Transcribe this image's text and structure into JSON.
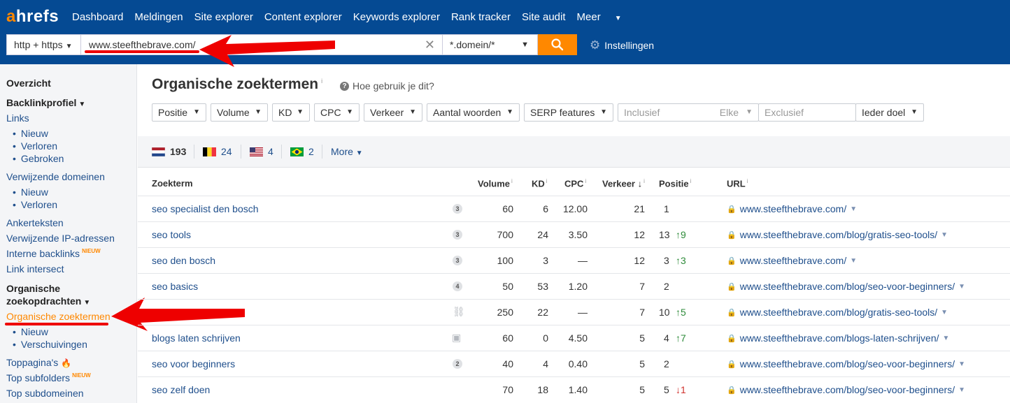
{
  "brand": {
    "logo_a": "a",
    "logo_rest": "hrefs",
    "accent": "#ff8800",
    "nav_bg": "#054a93"
  },
  "nav": {
    "items": [
      "Dashboard",
      "Meldingen",
      "Site explorer",
      "Content explorer",
      "Keywords explorer",
      "Rank tracker",
      "Site audit",
      "Meer"
    ]
  },
  "search": {
    "protocol": "http + https",
    "url": "www.steefthebrave.com/",
    "mode": "*.domein/*",
    "settings": "Instellingen"
  },
  "sidebar": {
    "overzicht": "Overzicht",
    "backlinkprofiel": "Backlinkprofiel",
    "links": "Links",
    "links_nieuw": "Nieuw",
    "links_verloren": "Verloren",
    "links_gebroken": "Gebroken",
    "ref_domains": "Verwijzende domeinen",
    "rd_nieuw": "Nieuw",
    "rd_verloren": "Verloren",
    "anchors": "Ankerteksten",
    "ref_ips": "Verwijzende IP-adressen",
    "internal": "Interne backlinks",
    "new_badge": "NIEUW",
    "link_intersect": "Link intersect",
    "organic_1": "Organische",
    "organic_2": "zoekopdrachten",
    "organic_kw": "Organische zoektermen",
    "org_nieuw": "Nieuw",
    "org_shifts": "Verschuivingen",
    "top_pages": "Toppagina's",
    "top_subfolders": "Top subfolders",
    "top_subdomains": "Top subdomeinen"
  },
  "page": {
    "title": "Organische zoektermen",
    "title_info": "i",
    "howto": "Hoe gebruik je dit?"
  },
  "filters": {
    "positie": "Positie",
    "volume": "Volume",
    "kd": "KD",
    "cpc": "CPC",
    "verkeer": "Verkeer",
    "aantal": "Aantal woorden",
    "serp": "SERP features",
    "inclusief": "Inclusief",
    "elke": "Elke",
    "exclusief": "Exclusief",
    "ieder": "Ieder doel"
  },
  "countries": [
    {
      "code": "NL",
      "count": "193"
    },
    {
      "code": "BE",
      "count": "24"
    },
    {
      "code": "US",
      "count": "4"
    },
    {
      "code": "BR",
      "count": "2"
    }
  ],
  "more": "More",
  "table": {
    "headers": {
      "keyword": "Zoekterm",
      "volume": "Volume",
      "kd": "KD",
      "cpc": "CPC",
      "traffic": "Verkeer",
      "position": "Positie",
      "url": "URL"
    },
    "rows": [
      {
        "keyword": "seo specialist den bosch",
        "badge": "3",
        "volume": "60",
        "kd": "6",
        "cpc": "12.00",
        "traffic": "21",
        "position": "1",
        "change": "",
        "url": "www.steefthebrave.com/"
      },
      {
        "keyword": "seo tools",
        "badge": "3",
        "volume": "700",
        "kd": "24",
        "cpc": "3.50",
        "traffic": "12",
        "position": "13",
        "change": "↑9",
        "url": "www.steefthebrave.com/blog/gratis-seo-tools/"
      },
      {
        "keyword": "seo den bosch",
        "badge": "3",
        "volume": "100",
        "kd": "3",
        "cpc": "—",
        "traffic": "12",
        "position": "3",
        "change": "↑3",
        "url": "www.steefthebrave.com/"
      },
      {
        "keyword": "seo basics",
        "badge": "4",
        "volume": "50",
        "kd": "53",
        "cpc": "1.20",
        "traffic": "7",
        "position": "2",
        "change": "",
        "url": "www.steefthebrave.com/blog/seo-voor-beginners/"
      },
      {
        "keyword": "",
        "badge": "",
        "volume": "250",
        "kd": "22",
        "cpc": "—",
        "traffic": "7",
        "position": "10",
        "change": "↑5",
        "url": "www.steefthebrave.com/blog/gratis-seo-tools/"
      },
      {
        "keyword": "blogs laten schrijven",
        "badge": "",
        "volume": "60",
        "kd": "0",
        "cpc": "4.50",
        "traffic": "5",
        "position": "4",
        "change": "↑7",
        "url": "www.steefthebrave.com/blogs-laten-schrijven/"
      },
      {
        "keyword": "seo voor beginners",
        "badge": "2",
        "volume": "40",
        "kd": "4",
        "cpc": "0.40",
        "traffic": "5",
        "position": "2",
        "change": "",
        "url": "www.steefthebrave.com/blog/seo-voor-beginners/"
      },
      {
        "keyword": "seo zelf doen",
        "badge": "",
        "volume": "70",
        "kd": "18",
        "cpc": "1.40",
        "traffic": "5",
        "position": "5",
        "change": "↓1",
        "url": "www.steefthebrave.com/blog/seo-voor-beginners/"
      }
    ]
  }
}
